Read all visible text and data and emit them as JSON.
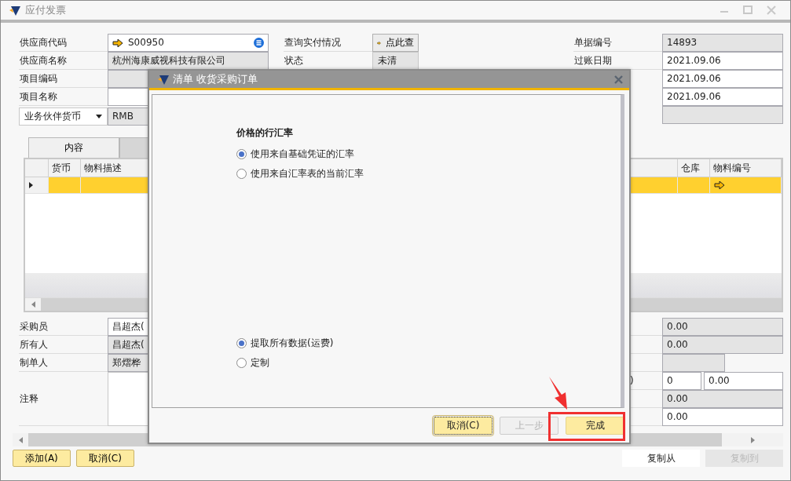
{
  "window": {
    "title": "应付发票"
  },
  "header": {
    "left": [
      {
        "label": "供应商代码",
        "value": "S00950",
        "kind": "link"
      },
      {
        "label": "供应商名称",
        "value": "杭州海康威视科技有限公司",
        "kind": "readonly"
      },
      {
        "label": "项目编码",
        "kind": "readonly"
      },
      {
        "label": "项目名称",
        "kind": "input"
      }
    ],
    "currency": {
      "select": "业务伙伴货币",
      "value": "RMB"
    },
    "middle": [
      {
        "label": "查询实付情况",
        "value": "点此查",
        "kind": "button"
      },
      {
        "label": "状态",
        "value": "未清",
        "kind": "select"
      }
    ],
    "right": [
      {
        "label": "单据编号",
        "value": "14893",
        "kind": "readonly"
      },
      {
        "label": "过账日期",
        "value": "2021.09.06",
        "kind": "input"
      },
      {
        "value": "2021.09.06",
        "kind": "input"
      },
      {
        "value": "2021.09.06",
        "kind": "input"
      },
      {
        "kind": "readonly"
      }
    ]
  },
  "tabs": [
    {
      "label": "内容",
      "selected": true
    },
    {
      "selected": false
    }
  ],
  "grid": {
    "columns": [
      {
        "label": "货币"
      },
      {
        "label": "物料描述"
      },
      {
        "label": "仓库"
      },
      {
        "label": "物料编号"
      }
    ],
    "rows": [
      {
        "selected": true
      }
    ]
  },
  "footer_left": [
    {
      "label": "采购员",
      "value": "昌超杰(",
      "kind": "input"
    },
    {
      "label": "所有人",
      "value": "昌超杰(",
      "kind": "readonly"
    },
    {
      "label": "制单人",
      "value": "郑熠桦",
      "kind": "readonly"
    },
    {
      "label": "注释",
      "kind": "textarea"
    }
  ],
  "footer_right": [
    {
      "value": "0.00",
      "kind": "readonly"
    },
    {
      "value": "0.00",
      "kind": "readonly"
    },
    {
      "kind": "short"
    },
    {
      "label": ")",
      "value": "0",
      "value2": "0.00",
      "kind": "pair"
    },
    {
      "value": "0.00",
      "kind": "readonly"
    },
    {
      "value": "0.00",
      "kind": "input"
    }
  ],
  "buttons_left": [
    {
      "label": "添加(A)"
    },
    {
      "label": "取消(C)"
    }
  ],
  "buttons_right": [
    {
      "label": "复制从",
      "disabled": false
    },
    {
      "label": "复制到",
      "disabled": true
    }
  ],
  "dialog": {
    "title": "清单 收货采购订单",
    "section": "价格的行汇率",
    "rate_options": [
      {
        "label": "使用来自基础凭证的汇率",
        "selected": true
      },
      {
        "label": "使用来自汇率表的当前汇率",
        "selected": false
      }
    ],
    "data_options": [
      {
        "label": "提取所有数据(运费)",
        "selected": true
      },
      {
        "label": "定制",
        "selected": false
      }
    ],
    "buttons": [
      {
        "label": "取消(C)",
        "kind": "focused"
      },
      {
        "label": "上一步",
        "kind": "disabled"
      },
      {
        "label": "完成",
        "kind": "primary",
        "highlighted": true
      }
    ]
  }
}
